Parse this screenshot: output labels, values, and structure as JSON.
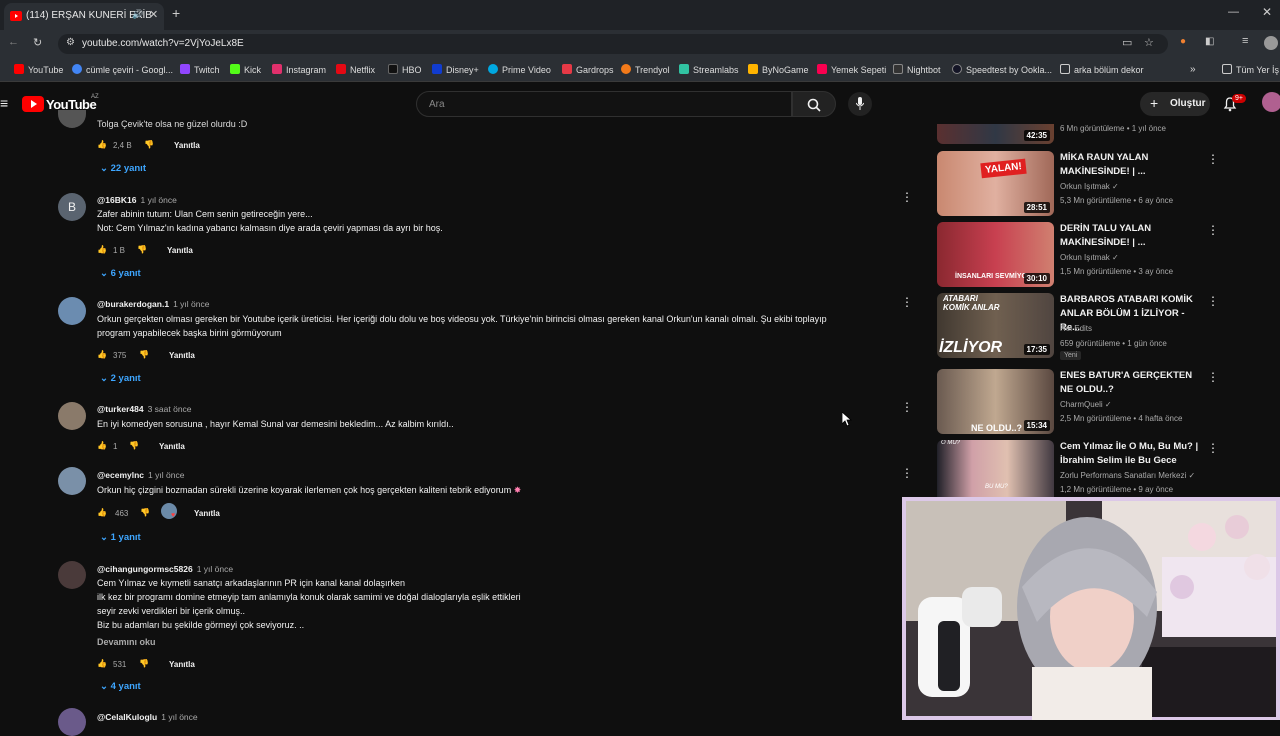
{
  "browser": {
    "tab_title": "(114) ERŞAN KUNERİ EKİB",
    "url": "youtube.com/watch?v=2VjYoJeLx8E",
    "bookmarks": [
      "YouTube",
      "cümle çeviri - Googl...",
      "Twitch",
      "Kick",
      "Instagram",
      "Netflix",
      "HBO",
      "Disney+",
      "Prime Video",
      "Gardrops",
      "Trendyol",
      "Streamlabs",
      "ByNoGame",
      "Yemek Sepeti",
      "Nightbot",
      "Speedtest by Ookla...",
      "arka bölüm dekor"
    ],
    "all_bookmarks": "Tüm Yer İş",
    "colors": {
      "tabbar": "#1f2226",
      "accent": "#3ea6ff"
    }
  },
  "youtube": {
    "logo": "YouTube",
    "region": "AZ",
    "search_placeholder": "Ara",
    "create_label": "Oluştur",
    "notif_count": "9+"
  },
  "top_comment": {
    "text": "Tolga Çevik'te olsa ne güzel olurdu :D",
    "likes": "2,4 B",
    "reply_label": "Yanıtla",
    "replies": "22 yanıt"
  },
  "comments": [
    {
      "author": "@16BK16",
      "time": "1 yıl önce",
      "avatar_letter": "B",
      "lines": [
        "Zafer abinin tutum: Ulan Cem senin getireceğin yere...",
        "Not: Cem Yılmaz'ın kadına yabancı kalmasın diye arada çeviri yapması da ayrı bir hoş."
      ],
      "likes": "1 B",
      "reply_label": "Yanıtla",
      "replies": "6 yanıt"
    },
    {
      "author": "@burakerdogan.1",
      "time": "1 yıl önce",
      "lines": [
        "Orkun gerçekten olması gereken bir Youtube içerik üreticisi. Her içeriği dolu dolu ve boş videosu yok. Türkiye'nin birincisi olması gereken kanal Orkun'un kanalı olmalı. Şu ekibi toplayıp",
        "program yapabilecek başka birini görmüyorum"
      ],
      "likes": "375",
      "reply_label": "Yanıtla",
      "replies": "2 yanıt"
    },
    {
      "author": "@turker484",
      "time": "3 saat önce",
      "lines": [
        "En iyi komedyen sorusuna , hayır Kemal Sunal var demesini bekledim... Az kalbim kırıldı.."
      ],
      "likes": "1",
      "reply_label": "Yanıtla"
    },
    {
      "author": "@ecemylnc",
      "time": "1 yıl önce",
      "lines": [
        "Orkun hiç çizgini bozmadan sürekli üzerine koyarak ilerlemen çok hoş gerçekten kaliteni tebrik ediyorum"
      ],
      "likes": "463",
      "reply_label": "Yanıtla",
      "replies": "1 yanıt"
    },
    {
      "author": "@cihangungormsc5826",
      "time": "1 yıl önce",
      "lines": [
        "Cem Yılmaz ve  kıymetli sanatçı arkadaşlarının  PR için kanal kanal  dolaşırken",
        "ilk kez bir programı domine etmeyip tam anlamıyla  konuk olarak samimi ve doğal dialoglarıyla eşlik ettikleri",
        "seyir zevki verdikleri bir içerik olmuş..",
        "Biz bu adamları bu şekilde görmeyi çok seviyoruz. .."
      ],
      "more": "Devamını oku",
      "likes": "531",
      "reply_label": "Yanıtla",
      "replies": "4 yanıt"
    },
    {
      "author": "@CelalKuloglu",
      "time": "1 yıl önce"
    }
  ],
  "sidebar": [
    {
      "duration": "42:35",
      "meta": "6 Mn görüntüleme • 1 yıl önce"
    },
    {
      "title": "MİKA RAUN YALAN MAKİNESİNDE! | ...",
      "channel": "Orkun Işıtmak",
      "meta": "5,3 Mn görüntüleme • 6 ay önce",
      "duration": "28:51",
      "thumb_text": "YALAN!"
    },
    {
      "title": "DERİN TALU YALAN MAKİNESİNDE! | ...",
      "channel": "Orkun Işıtmak",
      "meta": "1,5 Mn görüntüleme • 3 ay önce",
      "duration": "30:10",
      "thumb_text": "İNSANLARI SEVMİYO"
    },
    {
      "title": "BARBAROS ATABARI KOMİK ANLAR BÖLÜM 1 İZLİYOR - Re...",
      "channel": "Rei Edits",
      "meta": "659 görüntüleme • 1 gün önce",
      "badge": "Yeni",
      "duration": "17:35",
      "thumb_text": "ATABARI KOMİK ANLAR",
      "thumb_text2": "İZLİYOR"
    },
    {
      "title": "ENES BATUR'A GERÇEKTEN NE OLDU..?",
      "channel": "CharmQueli",
      "meta": "2,5 Mn görüntüleme • 4 hafta önce",
      "duration": "15:34",
      "thumb_text": "NE OLDU..?"
    },
    {
      "title": "Cem Yılmaz İle O Mu, Bu Mu? | İbrahim Selim ile Bu Gece",
      "channel": "Zorlu Performans Sanatları Merkezi",
      "meta": "1,2 Mn görüntüleme • 9 ay önce",
      "thumb_text": "O MU?",
      "thumb_text2": "BU MU?"
    }
  ]
}
